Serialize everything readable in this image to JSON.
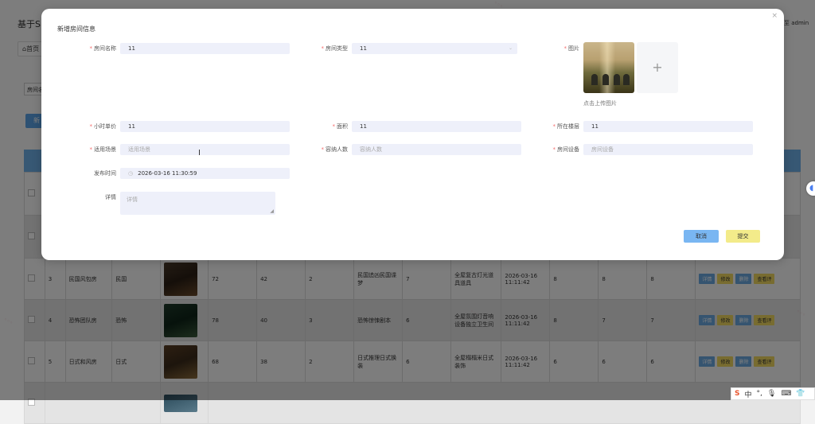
{
  "app": {
    "title": "基于Sp",
    "user": "至 admin",
    "home_tab": "首页"
  },
  "search": {
    "label": "房间名"
  },
  "add_button": "新",
  "table": {
    "rows": [
      {
        "no": "3",
        "name": "民国风包房",
        "type": "民国",
        "c1": "72",
        "c2": "42",
        "c3": "2",
        "scene": "民国追凶民国谍梦",
        "c4": "7",
        "equip": "全屋复古灯光道具道具",
        "time": "2026-03-16 11:11:42",
        "c5": "8",
        "c6": "8",
        "c7": "8"
      },
      {
        "no": "4",
        "name": "恐怖团队房",
        "type": "恐怖",
        "c1": "78",
        "c2": "40",
        "c3": "3",
        "scene": "恐怖惊悚剧本",
        "c4": "6",
        "equip": "全屋氛围灯音响设备独立卫生间",
        "time": "2026-03-16 11:11:42",
        "c5": "8",
        "c6": "7",
        "c7": "7"
      },
      {
        "no": "5",
        "name": "日式和风房",
        "type": "日式",
        "c1": "68",
        "c2": "38",
        "c3": "2",
        "scene": "日式推理日式换装",
        "c4": "6",
        "equip": "全屋榻榻米日式装饰",
        "time": "2026-03-16 11:11:42",
        "c5": "6",
        "c6": "6",
        "c7": "6"
      }
    ],
    "actions": {
      "detail": "详情",
      "edit": "修改",
      "delete": "删除",
      "view": "查看评"
    }
  },
  "modal": {
    "title": "新增房间信息",
    "fields": {
      "room_name": {
        "label": "房间名称",
        "value": "11"
      },
      "room_type": {
        "label": "房间类型",
        "value": "11"
      },
      "image": {
        "label": "图片",
        "hint": "点击上传图片"
      },
      "hourly_price": {
        "label": "小时单价",
        "value": "11"
      },
      "area": {
        "label": "面积",
        "value": "11"
      },
      "floor": {
        "label": "所在楼层",
        "value": "11"
      },
      "scene": {
        "label": "适用场景",
        "placeholder": "适用场景"
      },
      "capacity": {
        "label": "容纳人数",
        "placeholder": "容纳人数"
      },
      "equipment": {
        "label": "房间设备",
        "placeholder": "房间设备"
      },
      "publish_time": {
        "label": "发布时间",
        "value": "2026-03-16 11:30:59"
      },
      "detail": {
        "label": "详情",
        "placeholder": "详情"
      }
    },
    "cancel": "取消",
    "submit": "提交"
  },
  "ime": {
    "lang": "中"
  }
}
